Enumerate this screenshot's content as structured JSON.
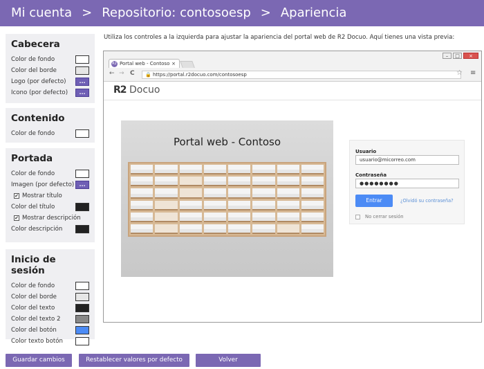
{
  "header": {
    "crumb1": "Mi cuenta",
    "sep": ">",
    "crumb2": "Repositorio: contosoesp",
    "crumb3": "Apariencia"
  },
  "cabecera": {
    "title": "Cabecera",
    "bg_color_label": "Color de fondo",
    "border_color_label": "Color del borde",
    "logo_label": "Logo (por defecto)",
    "icon_label": "Icono (por defecto)"
  },
  "contenido": {
    "title": "Contenido",
    "bg_color_label": "Color de fondo"
  },
  "portada": {
    "title": "Portada",
    "bg_color_label": "Color de fondo",
    "image_label": "Imagen (por defecto)",
    "show_title_label": "Mostrar título",
    "title_color_label": "Color del título",
    "show_desc_label": "Mostrar descripción",
    "desc_color_label": "Color descripción"
  },
  "login_panel": {
    "title": "Inicio de sesión",
    "bg_color_label": "Color de fondo",
    "border_color_label": "Color del borde",
    "text_color_label": "Color del texto",
    "text2_color_label": "Color del texto 2",
    "button_color_label": "Color del botón",
    "button_text_color_label": "Color texto botón"
  },
  "dots": "...",
  "check": "✔",
  "intro": "Utiliza los controles a la izquierda para ajustar la apariencia del portal web de R2 Docuo. Aquí tienes una vista previa:",
  "browser": {
    "tab_title": "Portal web - Contoso",
    "tab_close": "×",
    "favicon": "R2",
    "url": "https://portal.r2docuo.com/contosoesp",
    "back": "←",
    "forward": "→",
    "reload": "C",
    "star": "☆",
    "menu": "≡",
    "min": "–",
    "max": "□",
    "close": "×"
  },
  "portal": {
    "logo_r2": "R2",
    "logo_name": "Docuo",
    "banner_title": "Portal web - Contoso",
    "user_label": "Usuario",
    "user_value": "usuario@micorreo.com",
    "pass_label": "Contraseña",
    "pass_value": "●●●●●●●●",
    "login_button": "Entrar",
    "forgot": "¿Olvidó su contraseña?",
    "remember": "No cerrar sesión"
  },
  "actions": {
    "save": "Guardar cambios",
    "reset": "Restablecer valores por defecto",
    "back": "Volver"
  },
  "colors": {
    "header": "#7b68b3",
    "panel": "#efeff2",
    "swatch_white": "#ffffff",
    "swatch_light_gray": "#e6e6e6",
    "swatch_black": "#222222",
    "swatch_gray": "#888888",
    "swatch_blue": "#4c8bf5",
    "login_button": "#4c8bf5"
  }
}
